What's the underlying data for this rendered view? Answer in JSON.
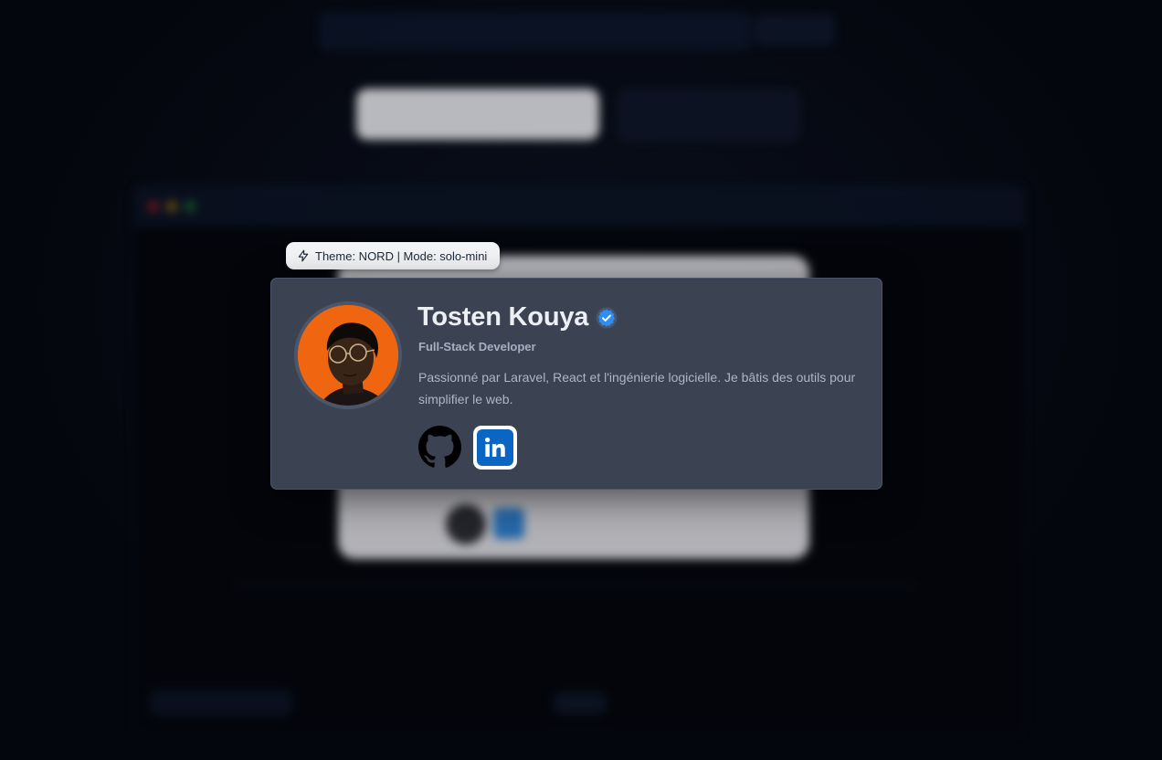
{
  "theme_badge": {
    "icon": "bolt-icon",
    "text": "Theme: NORD | Mode: solo-mini"
  },
  "profile": {
    "name": "Tosten Kouya",
    "verified": true,
    "verified_icon": "verified-badge-icon",
    "role": "Full-Stack Developer",
    "bio": "Passionné par Laravel, React et l'ingénierie logicielle. Je bâtis des outils pour simplifier le web.",
    "avatar_icon": "profile-photo",
    "socials": [
      {
        "name": "GitHub",
        "icon": "github-icon"
      },
      {
        "name": "LinkedIn",
        "icon": "linkedin-icon"
      }
    ]
  },
  "colors": {
    "card_background": "#3b4252",
    "card_border": "#4c566a",
    "name_text": "#eceff4",
    "muted_text": "#aeb6c4",
    "avatar_background": "#f0650f",
    "verified_blue": "#2b8ef0",
    "linkedin_blue": "#0a66c2",
    "page_background": "#050811"
  }
}
